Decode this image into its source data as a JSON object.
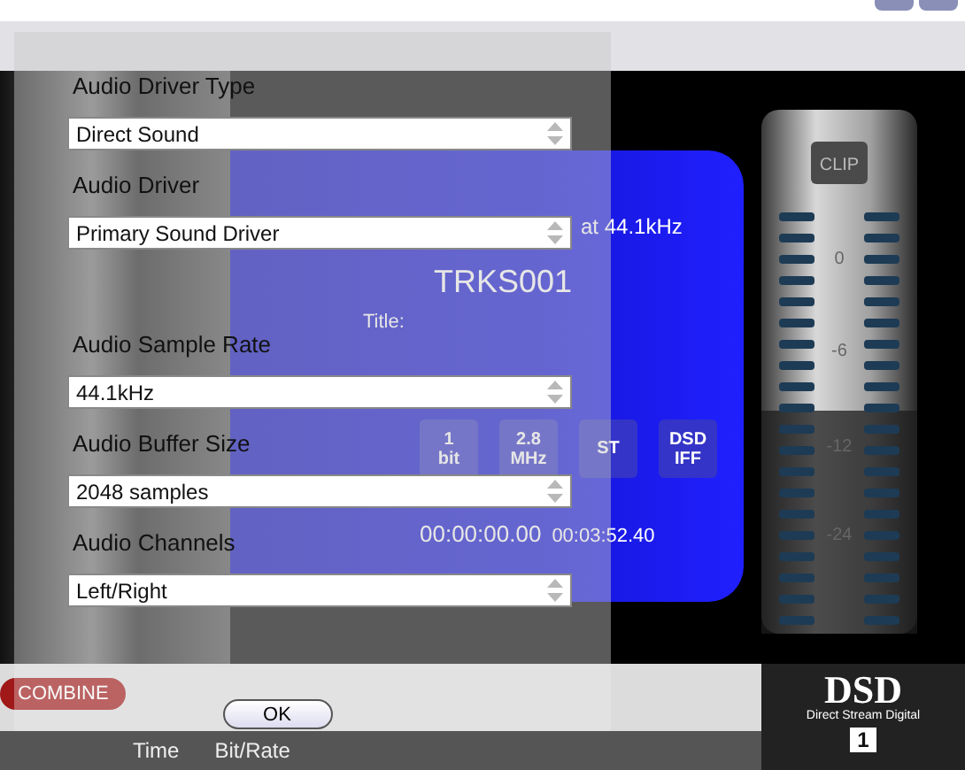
{
  "player": {
    "display": {
      "status": "at 44.1kHz",
      "track": "TRKS001",
      "fields": [
        "Title:"
      ],
      "badges": [
        "1\nbit",
        "2.8\nMHz",
        "ST",
        "DSD\nIFF"
      ],
      "times": [
        "00:00:00.00",
        "00:03:52.40"
      ]
    },
    "meter": {
      "clip": "CLIP",
      "scale": [
        "0",
        "-6",
        "-12",
        "-24"
      ]
    },
    "logo": {
      "mark": "DSD",
      "tagline": "Direct Stream Digital",
      "number": "1"
    },
    "combine": "COMBINE",
    "columns": [
      "Time",
      "Bit/Rate"
    ]
  },
  "dialog": {
    "settings": [
      {
        "label": "Audio Driver Type",
        "value": "Direct Sound"
      },
      {
        "label": "Audio Driver",
        "value": "Primary Sound Driver"
      },
      {
        "label": "Audio Sample Rate",
        "value": "44.1kHz"
      },
      {
        "label": "Audio Buffer Size",
        "value": "2048 samples"
      },
      {
        "label": "Audio Channels",
        "value": "Left/Right"
      }
    ],
    "ok": "OK"
  }
}
